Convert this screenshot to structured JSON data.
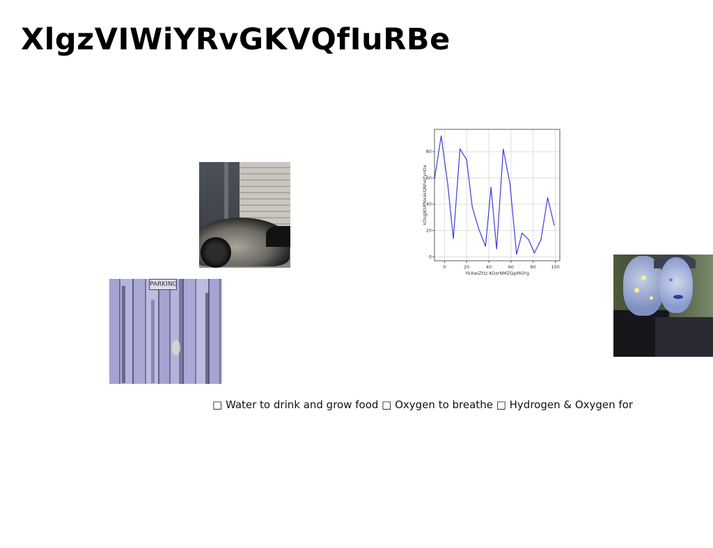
{
  "slide": {
    "title": "XlgzVIWiYRvGKVQfIuRBe",
    "bullet_text": "□ Water to drink and grow food □ Oxygen to breathe □ Hydrogen & Oxygen for"
  },
  "images": {
    "wood": {
      "sign_text": "PARKING"
    }
  },
  "chart_data": {
    "type": "line",
    "title": "",
    "xlabel": "YkXwiZttz KOzrNMZQpMGYg",
    "ylabel": "kDsgJKUPNxakQNheifynOa",
    "xlim": [
      -9,
      104
    ],
    "ylim": [
      -3,
      97
    ],
    "xticks": [
      0,
      20,
      40,
      60,
      80,
      100
    ],
    "yticks": [
      0,
      20,
      40,
      60,
      80
    ],
    "grid": true,
    "series": [
      {
        "color": "#3a3adf",
        "x": [
          -9,
          -3,
          3,
          8,
          14,
          20,
          25,
          31,
          37,
          42,
          47,
          53,
          59,
          65,
          70,
          76,
          81,
          87,
          93,
          99
        ],
        "y": [
          59,
          92,
          55,
          14,
          82,
          74,
          38,
          21,
          8,
          53,
          6,
          82,
          56,
          2,
          18,
          13,
          3,
          13,
          45,
          24
        ]
      }
    ]
  }
}
